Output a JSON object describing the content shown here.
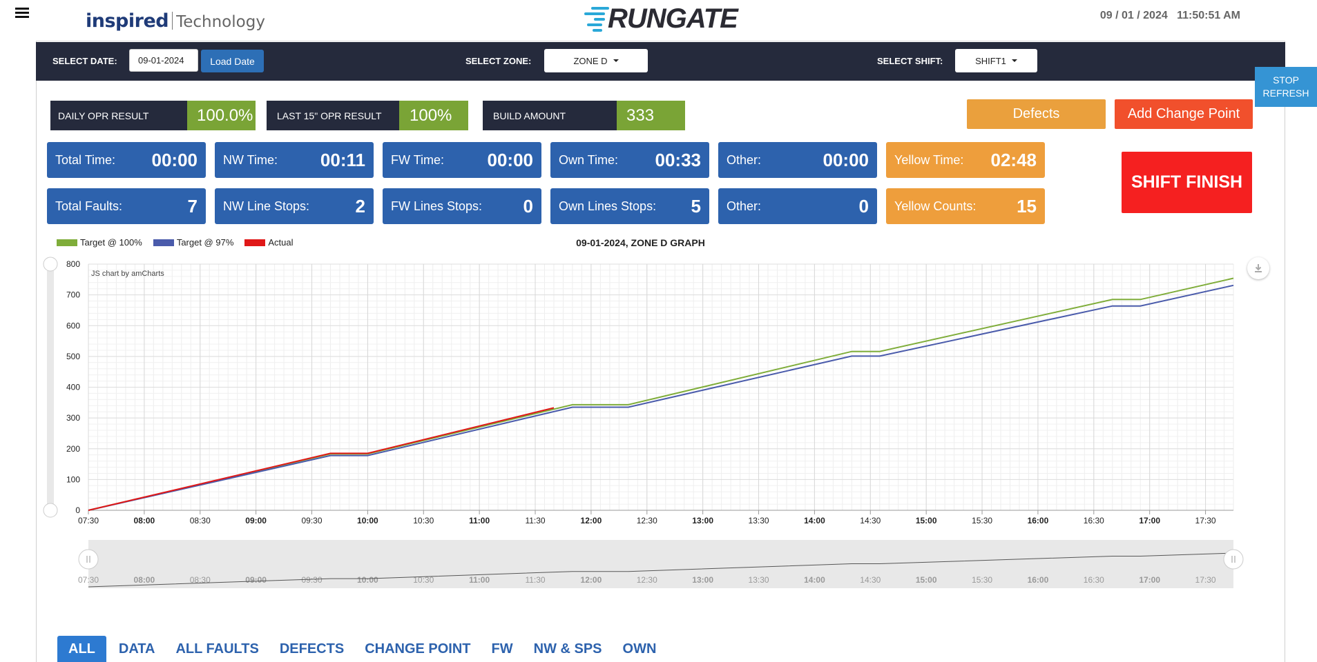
{
  "header": {
    "brand_primary": "inspired",
    "brand_secondary": "Technology",
    "logo_text": "RUNGATE",
    "date": "09 / 01 / 2024",
    "time": "11:50:51 AM"
  },
  "selectbar": {
    "date_label": "SELECT DATE:",
    "date_value": "09-01-2024",
    "load_button": "Load Date",
    "zone_label": "SELECT ZONE:",
    "zone_value": "ZONE D",
    "shift_label": "SELECT SHIFT:",
    "shift_value": "SHIFT1"
  },
  "stop_refresh": "STOP REFRESH",
  "results": [
    {
      "label": "DAILY OPR RESULT",
      "value": "100.0%"
    },
    {
      "label": "LAST 15\" OPR RESULT",
      "value": "100%"
    },
    {
      "label": "BUILD AMOUNT",
      "value": "333"
    }
  ],
  "actions": {
    "defects": "Defects",
    "add_change_point": "Add Change Point",
    "shift_finish": "SHIFT FINISH"
  },
  "time_cards": [
    {
      "label": "Total Time:",
      "value": "00:00"
    },
    {
      "label": "NW Time:",
      "value": "00:11"
    },
    {
      "label": "FW Time:",
      "value": "00:00"
    },
    {
      "label": "Own Time:",
      "value": "00:33"
    },
    {
      "label": "Other:",
      "value": "00:00"
    },
    {
      "label": "Yellow Time:",
      "value": "02:48"
    }
  ],
  "count_cards": [
    {
      "label": "Total Faults:",
      "value": "7"
    },
    {
      "label": "NW Line Stops:",
      "value": "2"
    },
    {
      "label": "FW Lines Stops:",
      "value": "0"
    },
    {
      "label": "Own Lines Stops:",
      "value": "5"
    },
    {
      "label": "Other:",
      "value": "0"
    },
    {
      "label": "Yellow Counts:",
      "value": "15"
    }
  ],
  "colors": {
    "navy": "#252a3c",
    "blue": "#2d62ad",
    "orange": "#ee9e3c",
    "green": "#7aa436",
    "red": "#f52020",
    "series_green": "#7fad3a",
    "series_blue": "#4a5bab",
    "series_red": "#e01818"
  },
  "chart_data": {
    "type": "line",
    "title": "09-01-2024, ZONE D GRAPH",
    "credit": "JS chart by amCharts",
    "ylim": [
      0,
      800
    ],
    "yticks": [
      0,
      100,
      200,
      300,
      400,
      500,
      600,
      700,
      800
    ],
    "x_range": [
      "07:30",
      "17:45"
    ],
    "xticks": [
      "07:30",
      "08:00",
      "08:30",
      "09:00",
      "09:30",
      "10:00",
      "10:30",
      "11:00",
      "11:30",
      "12:00",
      "12:30",
      "13:00",
      "13:30",
      "14:00",
      "14:30",
      "15:00",
      "15:30",
      "16:00",
      "16:30",
      "17:00",
      "17:30"
    ],
    "bold_ticks": [
      "08:00",
      "09:00",
      "10:00",
      "11:00",
      "12:00",
      "13:00",
      "14:00",
      "15:00",
      "16:00",
      "17:00"
    ],
    "grid": true,
    "legend_position": "top-left",
    "series": [
      {
        "name": "Target @ 100%",
        "color": "#7fad3a",
        "points": [
          [
            "07:30",
            0
          ],
          [
            "09:40",
            183
          ],
          [
            "10:00",
            183
          ],
          [
            "11:50",
            343
          ],
          [
            "12:20",
            343
          ],
          [
            "14:20",
            516
          ],
          [
            "14:35",
            516
          ],
          [
            "16:40",
            685
          ],
          [
            "16:55",
            685
          ],
          [
            "17:45",
            754
          ]
        ]
      },
      {
        "name": "Target @ 97%",
        "color": "#4a5bab",
        "points": [
          [
            "07:30",
            0
          ],
          [
            "09:40",
            178
          ],
          [
            "10:00",
            178
          ],
          [
            "11:50",
            335
          ],
          [
            "12:20",
            335
          ],
          [
            "14:20",
            501
          ],
          [
            "14:35",
            501
          ],
          [
            "16:40",
            664
          ],
          [
            "16:55",
            664
          ],
          [
            "17:45",
            731
          ]
        ]
      },
      {
        "name": "Actual",
        "color": "#e01818",
        "points": [
          [
            "07:30",
            0
          ],
          [
            "09:40",
            185
          ],
          [
            "10:00",
            185
          ],
          [
            "11:40",
            333
          ]
        ]
      }
    ]
  },
  "tabs": [
    "ALL",
    "DATA",
    "ALL FAULTS",
    "DEFECTS",
    "CHANGE POINT",
    "FW",
    "NW & SPS",
    "OWN"
  ],
  "active_tab": "ALL"
}
